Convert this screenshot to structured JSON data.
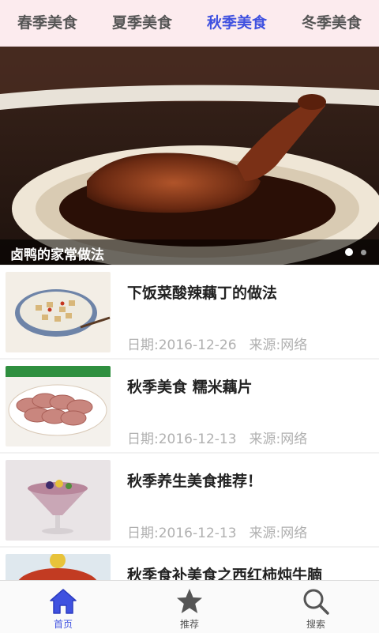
{
  "tabs": [
    {
      "label": "春季美食",
      "active": false
    },
    {
      "label": "夏季美食",
      "active": false
    },
    {
      "label": "秋季美食",
      "active": true
    },
    {
      "label": "冬季美食",
      "active": false
    }
  ],
  "banner": {
    "caption": "卤鸭的家常做法",
    "slide_count": 2,
    "current_slide": 1
  },
  "articles": [
    {
      "title": "下饭菜酸辣藕丁的做法",
      "date": "日期:2016-12-26",
      "source": "来源:网络"
    },
    {
      "title": "秋季美食 糯米藕片",
      "date": "日期:2016-12-13",
      "source": "来源:网络"
    },
    {
      "title": "秋季养生美食推荐！",
      "date": "日期:2016-12-13",
      "source": "来源:网络"
    },
    {
      "title": "秋季食补美食之西红柿炖牛腩",
      "date": "",
      "source": ""
    }
  ],
  "bottom_nav": [
    {
      "label": "首页",
      "icon": "home-icon",
      "active": true
    },
    {
      "label": "推荐",
      "icon": "star-icon",
      "active": false
    },
    {
      "label": "搜索",
      "icon": "search-icon",
      "active": false
    }
  ],
  "colors": {
    "accent": "#3f51e0",
    "tab_bar_bg": "#fcebee",
    "meta_text": "#b0b0b0"
  }
}
